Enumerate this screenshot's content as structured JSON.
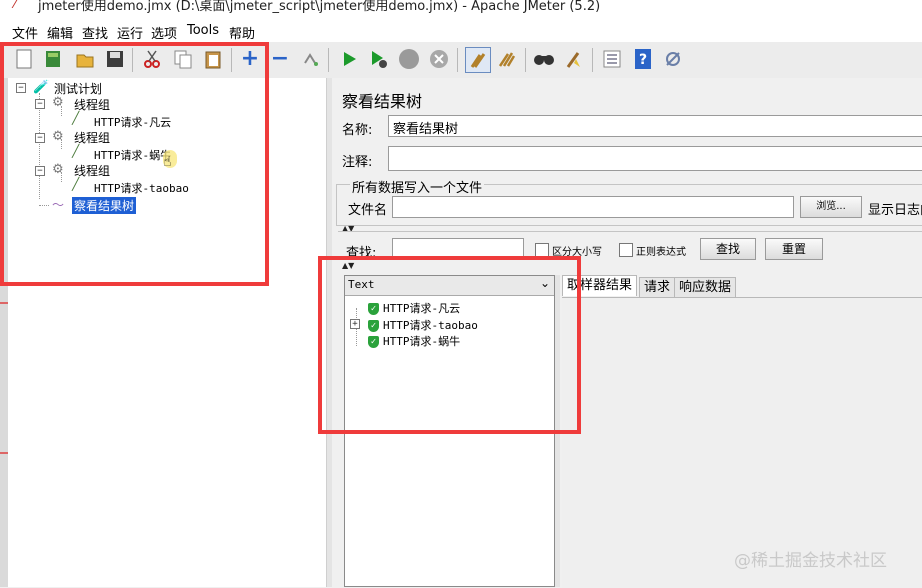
{
  "window": {
    "title": "jmeter使用demo.jmx (D:\\桌面\\jmeter_script\\jmeter使用demo.jmx) - Apache JMeter (5.2)"
  },
  "menu": {
    "items": [
      "文件",
      "编辑",
      "查找",
      "运行",
      "选项",
      "Tools",
      "帮助"
    ]
  },
  "toolbar": {
    "icons": [
      "new-icon",
      "templates-icon",
      "open-icon",
      "save-icon",
      "cut-icon",
      "copy-icon",
      "paste-icon",
      "expand-icon",
      "collapse-icon",
      "toggle-icon",
      "start-icon",
      "start-no-pause-icon",
      "stop-icon",
      "shutdown-icon",
      "clear-icon",
      "clear-all-icon",
      "search-icon",
      "reset-search-icon",
      "function-helper-icon",
      "help-icon",
      "remote-icon"
    ]
  },
  "tree": {
    "root": "测试计划",
    "groups": [
      {
        "label": "线程组",
        "child": "HTTP请求-凡云"
      },
      {
        "label": "线程组",
        "child": "HTTP请求-蜗牛"
      },
      {
        "label": "线程组",
        "child": "HTTP请求-taobao"
      }
    ],
    "listener": "察看结果树"
  },
  "panel": {
    "title": "察看结果树",
    "name_label": "名称:",
    "name_value": "察看结果树",
    "comment_label": "注释:",
    "comment_value": "",
    "write_all_title": "所有数据写入一个文件",
    "filename_label": "文件名",
    "filename_value": "",
    "browse_button": "浏览...",
    "log_toggle_label": "显示日志内",
    "find_label": "查找:",
    "find_value": "",
    "case_sensitive": "区分大小写",
    "regex": "正则表达式",
    "find_button": "查找",
    "reset_button": "重置",
    "renderer_select": "Text",
    "results": [
      "HTTP请求-凡云",
      "HTTP请求-taobao",
      "HTTP请求-蜗牛"
    ],
    "tabs": [
      "取样器结果",
      "请求",
      "响应数据"
    ]
  },
  "colors": {
    "highlight": "#ef3b3b",
    "selection": "#1e5fd4",
    "success": "#2aa23b"
  },
  "watermark": "@稀土掘金技术社区"
}
